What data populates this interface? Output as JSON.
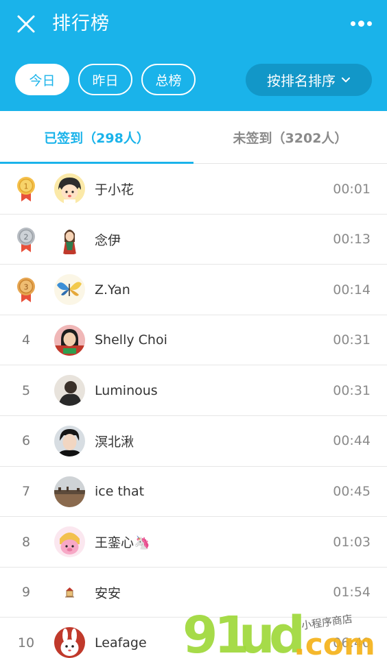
{
  "header": {
    "title": "排行榜",
    "filters": [
      "今日",
      "昨日",
      "总榜"
    ],
    "active_filter": "今日",
    "sort_label": "按排名排序",
    "brand_color": "#1ab3ea"
  },
  "tabs": {
    "signed": "已签到（298人）",
    "unsigned": "未签到（3202人）"
  },
  "rows": [
    {
      "rank": "1",
      "name": "于小花",
      "time": "00:01",
      "medal": "gold"
    },
    {
      "rank": "2",
      "name": "念伊",
      "time": "00:13",
      "medal": "silver"
    },
    {
      "rank": "3",
      "name": "Z.Yan",
      "time": "00:14",
      "medal": "bronze"
    },
    {
      "rank": "4",
      "name": "Shelly Choi",
      "time": "00:31"
    },
    {
      "rank": "5",
      "name": "Luminous",
      "time": "00:31"
    },
    {
      "rank": "6",
      "name": "溟北湫",
      "time": "00:44"
    },
    {
      "rank": "7",
      "name": "ice that",
      "time": "00:45"
    },
    {
      "rank": "8",
      "name": "王銮心🦄",
      "time": "01:03"
    },
    {
      "rank": "9",
      "name": "安安",
      "time": "01:54"
    },
    {
      "rank": "10",
      "name": "Leafage",
      "time": "06:40"
    }
  ],
  "watermark": {
    "logo": "91ud.com",
    "caption": "小程序商店"
  }
}
